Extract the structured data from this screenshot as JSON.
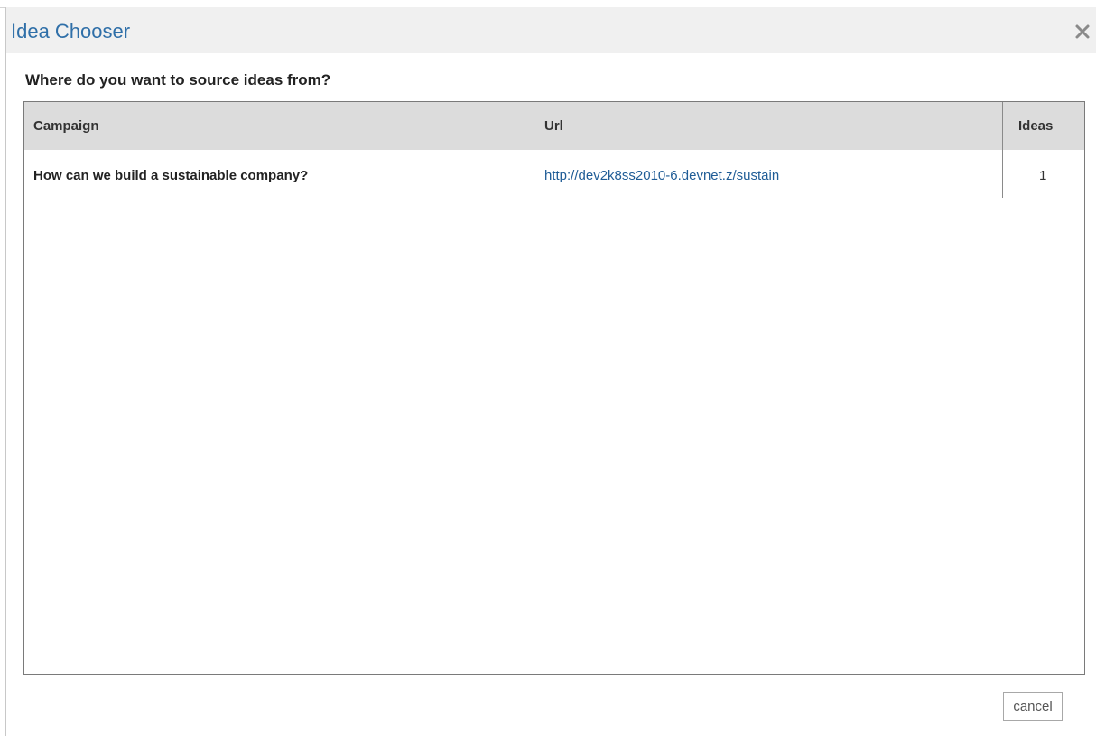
{
  "dialog": {
    "title": "Idea Chooser",
    "close_icon": "close-icon",
    "prompt": "Where do you want to source ideas from?"
  },
  "table": {
    "columns": [
      "Campaign",
      "Url",
      "Ideas"
    ],
    "rows": [
      {
        "campaign": "How can we build a sustainable company?",
        "url": "http://dev2k8ss2010-6.devnet.z/sustain",
        "ideas": "1"
      }
    ]
  },
  "footer": {
    "cancel_label": "cancel"
  },
  "colors": {
    "title": "#2f6fa8",
    "link": "#1f5c96",
    "header_bg": "#dcdcdc",
    "dialog_header_bg": "#f0f0f0"
  }
}
